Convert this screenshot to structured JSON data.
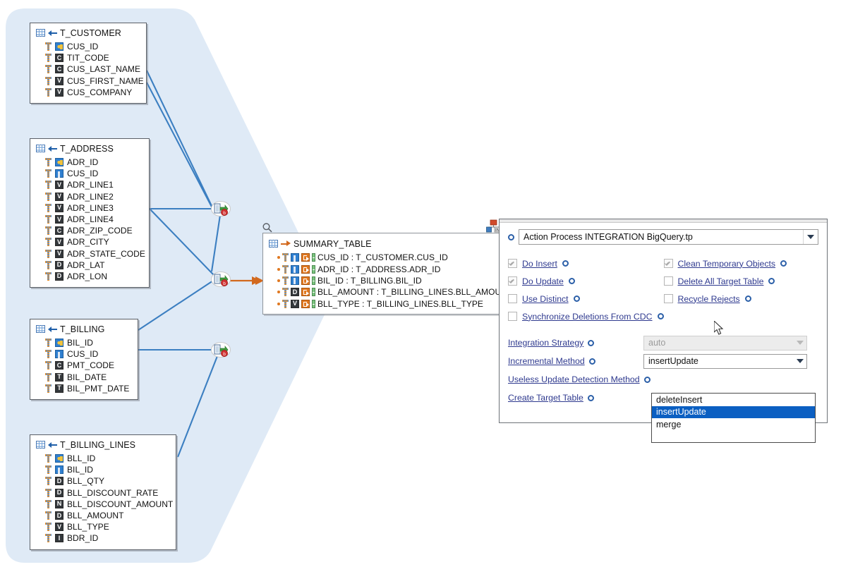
{
  "diagram": {
    "entities": [
      {
        "name": "T_CUSTOMER",
        "columns": [
          {
            "name": "CUS_ID",
            "type": "key"
          },
          {
            "name": "TIT_CODE",
            "type": "C"
          },
          {
            "name": "CUS_LAST_NAME",
            "type": "C"
          },
          {
            "name": "CUS_FIRST_NAME",
            "type": "V"
          },
          {
            "name": "CUS_COMPANY",
            "type": "V"
          }
        ]
      },
      {
        "name": "T_ADDRESS",
        "columns": [
          {
            "name": "ADR_ID",
            "type": "key"
          },
          {
            "name": "CUS_ID",
            "type": "fk"
          },
          {
            "name": "ADR_LINE1",
            "type": "V"
          },
          {
            "name": "ADR_LINE2",
            "type": "V"
          },
          {
            "name": "ADR_LINE3",
            "type": "V"
          },
          {
            "name": "ADR_LINE4",
            "type": "V"
          },
          {
            "name": "ADR_ZIP_CODE",
            "type": "C"
          },
          {
            "name": "ADR_CITY",
            "type": "V"
          },
          {
            "name": "ADR_STATE_CODE",
            "type": "V"
          },
          {
            "name": "ADR_LAT",
            "type": "D"
          },
          {
            "name": "ADR_LON",
            "type": "D"
          }
        ]
      },
      {
        "name": "T_BILLING",
        "columns": [
          {
            "name": "BIL_ID",
            "type": "key"
          },
          {
            "name": "CUS_ID",
            "type": "fk"
          },
          {
            "name": "PMT_CODE",
            "type": "C"
          },
          {
            "name": "BIL_DATE",
            "type": "T"
          },
          {
            "name": "BIL_PMT_DATE",
            "type": "T"
          }
        ]
      },
      {
        "name": "T_BILLING_LINES",
        "columns": [
          {
            "name": "BLL_ID",
            "type": "key"
          },
          {
            "name": "BIL_ID",
            "type": "fk"
          },
          {
            "name": "BLL_QTY",
            "type": "D"
          },
          {
            "name": "BLL_DISCOUNT_RATE",
            "type": "D"
          },
          {
            "name": "BLL_DISCOUNT_AMOUNT",
            "type": "N"
          },
          {
            "name": "BLL_AMOUNT",
            "type": "D"
          },
          {
            "name": "BLL_TYPE",
            "type": "V"
          },
          {
            "name": "BDR_ID",
            "type": "I"
          }
        ]
      }
    ],
    "target": {
      "name": "SUMMARY_TABLE",
      "columns": [
        {
          "name": "CUS_ID : T_CUSTOMER.CUS_ID",
          "type": "fk"
        },
        {
          "name": "ADR_ID : T_ADDRESS.ADR_ID",
          "type": "fk"
        },
        {
          "name": "BIL_ID : T_BILLING.BIL_ID",
          "type": "fk"
        },
        {
          "name": "BLL_AMOUNT : T_BILLING_LINES.BLL_AMOUNT",
          "type": "D"
        },
        {
          "name": "BLL_TYPE : T_BILLING_LINES.BLL_TYPE",
          "type": "V"
        }
      ]
    },
    "colors": {
      "link": "#3c7fc1",
      "group_fill": "#dfeaf6",
      "flow_arrow": "#d2691e"
    }
  },
  "dialog": {
    "process_combo": {
      "value": "Action Process INTEGRATION BigQuery.tp"
    },
    "checkboxes_left": [
      {
        "label": "Do Insert",
        "checked": true
      },
      {
        "label": "Do Update",
        "checked": true
      },
      {
        "label": "Use Distinct",
        "checked": false
      },
      {
        "label": "Synchronize Deletions From CDC",
        "checked": false
      }
    ],
    "checkboxes_right": [
      {
        "label": "Clean Temporary Objects ",
        "checked": true
      },
      {
        "label": "Delete All Target Table",
        "checked": false
      },
      {
        "label": "Recycle Rejects",
        "checked": false
      }
    ],
    "fields": [
      {
        "label": "Integration Strategy",
        "value": "auto",
        "disabled": true
      },
      {
        "label": "Incremental Method",
        "value": "insertUpdate",
        "disabled": false
      },
      {
        "label": "Useless Update Detection Method",
        "value": "",
        "disabled": false
      },
      {
        "label": "Create Target Table",
        "value": "",
        "disabled": false
      }
    ],
    "dropdown": {
      "open": true,
      "options": [
        "deleteInsert",
        "insertUpdate",
        "merge"
      ],
      "selected": "insertUpdate",
      "highlight_color": "#0b5fc2"
    }
  }
}
